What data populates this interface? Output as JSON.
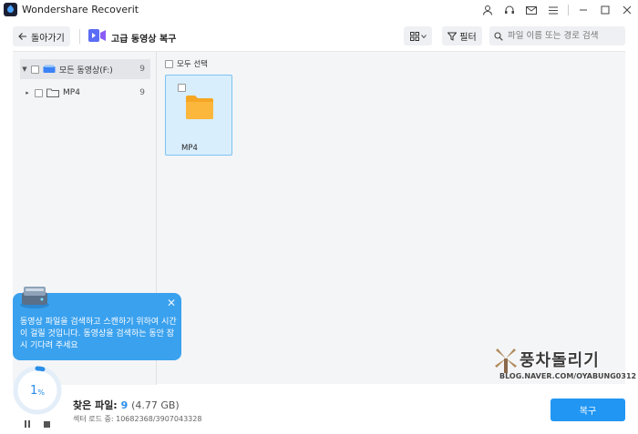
{
  "window": {
    "title": "Wondershare Recoverit"
  },
  "toolbar": {
    "back_label": "돌아가기",
    "mode_label": "고급 동영상 복구",
    "filter_label": "필터",
    "search_placeholder": "파일 이름 또는 경로 검색"
  },
  "tree": {
    "items": [
      {
        "label": "모든 동영상(F:)",
        "count": "9",
        "expanded": true,
        "selected": true
      },
      {
        "label": "MP4",
        "count": "9",
        "expanded": false,
        "selected": false
      }
    ]
  },
  "files": {
    "select_all_label": "모두 선택",
    "items": [
      {
        "name": "MP4",
        "type": "folder"
      }
    ]
  },
  "tooltip": {
    "text": "동영상 파일을 검색하고 스캔하기 위하여 시간이 걸릴 것입니다. 동영상을 검색하는 동안 잠시 기다려 주세요"
  },
  "scan": {
    "progress_percent": 1,
    "progress_number": "1",
    "progress_unit": "%",
    "found_label": "찾은 파일:",
    "found_count": "9",
    "found_size": "(4.77 GB)",
    "sector_text": "섹터 로드 중: 10682368/3907043328"
  },
  "recover_label": "복구",
  "watermark": {
    "title": "풍차돌리기",
    "subtitle": "BLOG.NAVER.COM/OYABUNG0312"
  },
  "colors": {
    "accent": "#2196f3",
    "tooltip": "#3aa1ee",
    "selection_fill": "#d8eefc",
    "folder": "#f5a623"
  },
  "icons": [
    "app-logo",
    "user-icon",
    "headset-icon",
    "mail-icon",
    "settings-icon",
    "minimize-icon",
    "maximize-icon",
    "close-icon",
    "back-arrow-icon",
    "video-camera-icon",
    "grid-view-icon",
    "filter-icon",
    "search-icon",
    "drive-icon",
    "folder-icon",
    "pause-icon",
    "stop-icon"
  ]
}
